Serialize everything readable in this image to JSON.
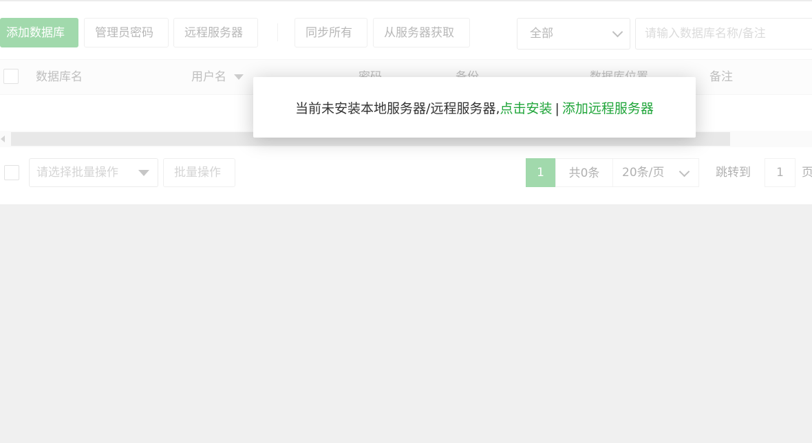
{
  "colors": {
    "accent": "#20a53a",
    "page_bg": "#f0f0f0"
  },
  "toolbar": {
    "add_db": "添加数据库",
    "admin_password": "管理员密码",
    "remote_server": "远程服务器",
    "sync_all": "同步所有",
    "fetch_from_server": "从服务器获取",
    "filter_selected": "全部",
    "search_placeholder": "请输入数据库名称/备注"
  },
  "table": {
    "columns": [
      "数据库名",
      "用户名",
      "密码",
      "备份",
      "数据库位置",
      "备注"
    ],
    "sort_icon": "caret-down-icon"
  },
  "footer": {
    "batch_placeholder": "请选择批量操作",
    "batch_button": "批量操作",
    "current_page": "1",
    "total": "共0条",
    "page_size": "20条/页",
    "jump_label": "跳转到",
    "jump_value": "1",
    "page_unit": "页"
  },
  "dialog": {
    "message": "当前未安装本地服务器/远程服务器,",
    "install_link": "点击安装",
    "separator": "|",
    "add_remote_link": "添加远程服务器"
  }
}
